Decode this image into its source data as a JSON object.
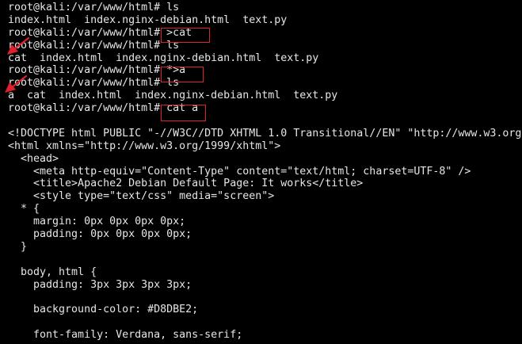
{
  "terminal": {
    "session_lines": [
      "root@kali:/var/www/html# ls",
      "index.html  index.nginx-debian.html  text.py",
      "root@kali:/var/www/html# >cat",
      "root@kali:/var/www/html# ls",
      "cat  index.html  index.nginx-debian.html  text.py",
      "root@kali:/var/www/html# *>a",
      "root@kali:/var/www/html# ls",
      "a  cat  index.html  index.nginx-debian.html  text.py",
      "root@kali:/var/www/html# cat a"
    ],
    "output_lines": [
      "<!DOCTYPE html PUBLIC \"-//W3C//DTD XHTML 1.0 Transitional//EN\" \"http://www.w3.org/",
      "<html xmlns=\"http://www.w3.org/1999/xhtml\">",
      "  <head>",
      "    <meta http-equiv=\"Content-Type\" content=\"text/html; charset=UTF-8\" />",
      "    <title>Apache2 Debian Default Page: It works</title>",
      "    <style type=\"text/css\" media=\"screen\">",
      "  * {",
      "    margin: 0px 0px 0px 0px;",
      "    padding: 0px 0px 0px 0px;",
      "  }",
      "",
      "  body, html {",
      "    padding: 3px 3px 3px 3px;",
      "",
      "    background-color: #D8DBE2;",
      "",
      "    font-family: Verdana, sans-serif;"
    ]
  },
  "colors": {
    "background": "#000000",
    "text": "#e6e6e6",
    "annotation": "#e0202a"
  }
}
